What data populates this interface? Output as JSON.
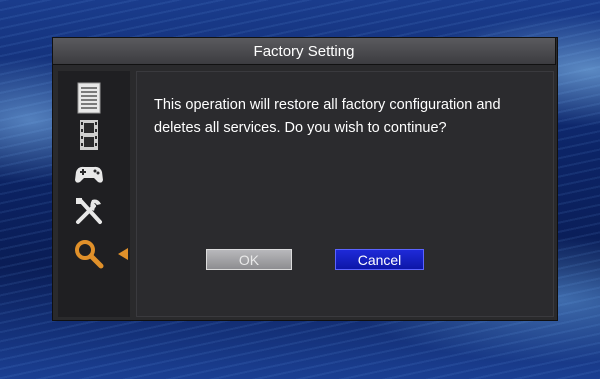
{
  "window": {
    "title": "Factory Setting"
  },
  "sidebar": {
    "items": [
      {
        "icon": "document-icon"
      },
      {
        "icon": "film-icon"
      },
      {
        "icon": "gamepad-icon"
      },
      {
        "icon": "tools-icon"
      },
      {
        "icon": "search-icon",
        "selected": true
      }
    ]
  },
  "dialog": {
    "message": "This operation will restore all factory configuration and deletes all services. Do you wish to continue?",
    "ok_label": "OK",
    "cancel_label": "Cancel",
    "focused_button": "Cancel"
  },
  "colors": {
    "selected_icon": "#e0902a",
    "focused_button": "#1e2ad8",
    "disabled_button": "#a4a4a7"
  }
}
